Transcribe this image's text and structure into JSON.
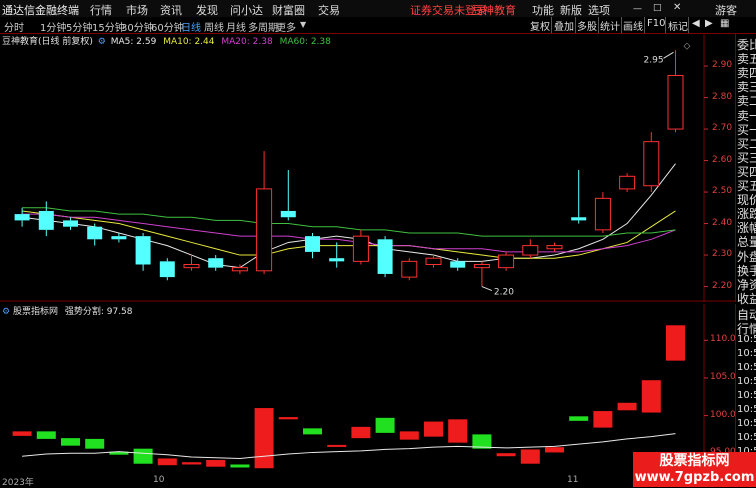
{
  "menubar": {
    "app_title": "通达信金融终端",
    "menus": [
      "行情",
      "市场",
      "资讯",
      "发现",
      "问小达",
      "财富圈",
      "交易"
    ],
    "login_notice": "证券交易未登录",
    "broker": "豆神教育",
    "right_menus": [
      "功能",
      "新版",
      "选项"
    ],
    "user": "游客"
  },
  "timeframes": [
    "分时",
    "1分钟",
    "5分钟",
    "15分钟",
    "30分钟",
    "60分钟",
    "日线",
    "周线",
    "月线",
    "多周期",
    "更多"
  ],
  "active_timeframe": "日线",
  "toolbar": [
    "复权",
    "叠加",
    "多股",
    "统计",
    "画线",
    "F10",
    "标记"
  ],
  "main_chart": {
    "title": "豆神教育(日线 前复权)",
    "ma_labels": [
      {
        "label": "MA5: 2.59",
        "color": "#e8e8e8"
      },
      {
        "label": "MA10: 2.44",
        "color": "#e8e840"
      },
      {
        "label": "MA20: 2.38",
        "color": "#d040d0"
      },
      {
        "label": "MA60: 2.38",
        "color": "#40c040"
      }
    ],
    "axis_labels": [
      "2.90",
      "2.80",
      "2.70",
      "2.60",
      "2.50",
      "2.40",
      "2.30",
      "2.20"
    ],
    "high_mark": "2.95",
    "low_mark": "2.20"
  },
  "right_panel": [
    "委比",
    "卖五",
    "卖四",
    "卖三",
    "卖二",
    "卖一",
    "买一",
    "买二",
    "买三",
    "买四",
    "买五",
    "现价",
    "涨跌",
    "涨幅",
    "总量",
    "外盘",
    "换手",
    "净资",
    "收益"
  ],
  "right_panel2": [
    "自动",
    "行情",
    "10:5",
    "10:5",
    "10:5",
    "10:5",
    "10:5",
    "10:5",
    "10:5",
    "10:5",
    "10:5"
  ],
  "indicator": {
    "title": "股票指标网",
    "name_label": "强势分割: 97.58",
    "axis_labels": [
      "110.0",
      "105.0",
      "100.0",
      "95.00"
    ]
  },
  "dates": [
    "2023年",
    "10",
    "11"
  ],
  "watermark": {
    "line1": "股票指标网",
    "line2": "www.7gpzb.com"
  },
  "chart_data": {
    "type": "candlestick",
    "price_axis": [
      2.17,
      2.97
    ],
    "candles": [
      {
        "o": 2.43,
        "c": 2.41,
        "h": 2.45,
        "l": 2.39
      },
      {
        "o": 2.44,
        "c": 2.38,
        "h": 2.47,
        "l": 2.36
      },
      {
        "o": 2.41,
        "c": 2.39,
        "h": 2.42,
        "l": 2.38
      },
      {
        "o": 2.39,
        "c": 2.35,
        "h": 2.4,
        "l": 2.33
      },
      {
        "o": 2.36,
        "c": 2.35,
        "h": 2.37,
        "l": 2.34
      },
      {
        "o": 2.36,
        "c": 2.27,
        "h": 2.37,
        "l": 2.25
      },
      {
        "o": 2.28,
        "c": 2.23,
        "h": 2.29,
        "l": 2.22
      },
      {
        "o": 2.26,
        "c": 2.27,
        "h": 2.3,
        "l": 2.25
      },
      {
        "o": 2.29,
        "c": 2.26,
        "h": 2.3,
        "l": 2.25
      },
      {
        "o": 2.25,
        "c": 2.26,
        "h": 2.27,
        "l": 2.24
      },
      {
        "o": 2.25,
        "c": 2.51,
        "h": 2.63,
        "l": 2.24
      },
      {
        "o": 2.44,
        "c": 2.42,
        "h": 2.57,
        "l": 2.41
      },
      {
        "o": 2.36,
        "c": 2.31,
        "h": 2.37,
        "l": 2.29
      },
      {
        "o": 2.29,
        "c": 2.28,
        "h": 2.34,
        "l": 2.26
      },
      {
        "o": 2.28,
        "c": 2.36,
        "h": 2.38,
        "l": 2.27
      },
      {
        "o": 2.35,
        "c": 2.24,
        "h": 2.36,
        "l": 2.23
      },
      {
        "o": 2.23,
        "c": 2.28,
        "h": 2.29,
        "l": 2.22
      },
      {
        "o": 2.27,
        "c": 2.29,
        "h": 2.3,
        "l": 2.26
      },
      {
        "o": 2.28,
        "c": 2.26,
        "h": 2.29,
        "l": 2.25
      },
      {
        "o": 2.26,
        "c": 2.27,
        "h": 2.28,
        "l": 2.2
      },
      {
        "o": 2.26,
        "c": 2.3,
        "h": 2.31,
        "l": 2.25
      },
      {
        "o": 2.3,
        "c": 2.33,
        "h": 2.35,
        "l": 2.29
      },
      {
        "o": 2.32,
        "c": 2.33,
        "h": 2.34,
        "l": 2.31
      },
      {
        "o": 2.42,
        "c": 2.41,
        "h": 2.57,
        "l": 2.4
      },
      {
        "o": 2.38,
        "c": 2.48,
        "h": 2.5,
        "l": 2.37
      },
      {
        "o": 2.51,
        "c": 2.55,
        "h": 2.56,
        "l": 2.5
      },
      {
        "o": 2.52,
        "c": 2.66,
        "h": 2.69,
        "l": 2.5
      },
      {
        "o": 2.7,
        "c": 2.87,
        "h": 2.95,
        "l": 2.69
      }
    ],
    "ma_series": [
      {
        "name": "MA5",
        "color": "#e8e8e8",
        "values": [
          2.42,
          2.41,
          2.4,
          2.39,
          2.37,
          2.35,
          2.33,
          2.3,
          2.27,
          2.26,
          2.31,
          2.34,
          2.35,
          2.36,
          2.35,
          2.32,
          2.31,
          2.3,
          2.28,
          2.28,
          2.29,
          2.29,
          2.3,
          2.32,
          2.35,
          2.4,
          2.49,
          2.59
        ]
      },
      {
        "name": "MA10",
        "color": "#e8e840",
        "values": [
          2.44,
          2.43,
          2.42,
          2.41,
          2.4,
          2.38,
          2.36,
          2.34,
          2.32,
          2.3,
          2.3,
          2.32,
          2.33,
          2.33,
          2.33,
          2.33,
          2.33,
          2.32,
          2.31,
          2.3,
          2.29,
          2.29,
          2.29,
          2.3,
          2.32,
          2.34,
          2.39,
          2.44
        ]
      },
      {
        "name": "MA20",
        "color": "#d040d0",
        "values": [
          2.43,
          2.43,
          2.42,
          2.42,
          2.41,
          2.4,
          2.39,
          2.38,
          2.37,
          2.36,
          2.36,
          2.36,
          2.35,
          2.35,
          2.34,
          2.33,
          2.33,
          2.32,
          2.32,
          2.32,
          2.31,
          2.31,
          2.31,
          2.31,
          2.32,
          2.33,
          2.35,
          2.38
        ]
      },
      {
        "name": "MA60",
        "color": "#40c040",
        "values": [
          2.45,
          2.45,
          2.44,
          2.44,
          2.43,
          2.43,
          2.42,
          2.42,
          2.41,
          2.41,
          2.4,
          2.4,
          2.39,
          2.39,
          2.38,
          2.38,
          2.37,
          2.37,
          2.37,
          2.36,
          2.36,
          2.36,
          2.36,
          2.36,
          2.36,
          2.37,
          2.37,
          2.38
        ]
      }
    ],
    "indicator_axis": [
      92.5,
      113.5
    ],
    "indicator_bars": [
      {
        "o": 97.3,
        "c": 97.9
      },
      {
        "o": 97.9,
        "c": 96.9
      },
      {
        "o": 97.0,
        "c": 96.0
      },
      {
        "o": 96.9,
        "c": 95.6
      },
      {
        "o": 95.2,
        "c": 94.8
      },
      {
        "o": 95.6,
        "c": 93.6
      },
      {
        "o": 93.4,
        "c": 94.3
      },
      {
        "o": 93.5,
        "c": 93.8
      },
      {
        "o": 93.2,
        "c": 94.1
      },
      {
        "o": 93.5,
        "c": 93.1
      },
      {
        "o": 93.0,
        "c": 101.0
      },
      {
        "o": 99.5,
        "c": 99.8
      },
      {
        "o": 98.3,
        "c": 97.5
      },
      {
        "o": 96.0,
        "c": 96.1
      },
      {
        "o": 97.0,
        "c": 98.5
      },
      {
        "o": 99.7,
        "c": 97.7
      },
      {
        "o": 96.8,
        "c": 97.9
      },
      {
        "o": 97.2,
        "c": 99.2
      },
      {
        "o": 96.4,
        "c": 99.5
      },
      {
        "o": 97.5,
        "c": 95.6
      },
      {
        "o": 94.6,
        "c": 95.0
      },
      {
        "o": 93.6,
        "c": 95.5
      },
      {
        "o": 95.1,
        "c": 95.8
      },
      {
        "o": 99.9,
        "c": 99.3
      },
      {
        "o": 98.4,
        "c": 100.6
      },
      {
        "o": 100.7,
        "c": 101.7
      },
      {
        "o": 100.4,
        "c": 104.7
      },
      {
        "o": 107.3,
        "c": 112.0
      }
    ],
    "indicator_line": [
      94.6,
      94.9,
      95.0,
      95.0,
      95.2,
      95.0,
      94.8,
      94.5,
      94.4,
      94.3,
      94.6,
      94.9,
      95.1,
      95.2,
      95.3,
      95.5,
      95.6,
      95.8,
      95.9,
      95.8,
      95.7,
      95.8,
      95.9,
      96.2,
      96.5,
      96.9,
      97.2,
      97.6
    ]
  }
}
